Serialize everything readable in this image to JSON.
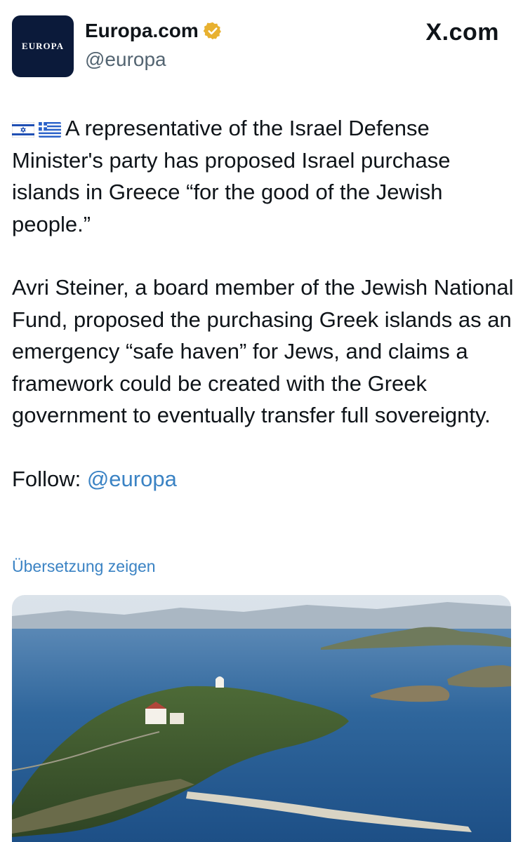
{
  "header": {
    "avatar_text": "EUROPA",
    "display_name": "Europa.com",
    "handle": "@europa",
    "site_label": "X.com",
    "verified_icon": "gold-verified-badge-icon"
  },
  "tweet": {
    "flags": [
      "israel-flag-icon",
      "greece-flag-icon"
    ],
    "paragraph1": "A representative of the Israel Defense Minister's party has proposed Israel purchase islands in Greece “for the good of the Jewish people.”",
    "paragraph2": "Avri Steiner, a board member of the Jewish National Fund, proposed the purchasing Greek islands as an emergency “safe haven” for Jews, and claims a framework could be created with the Greek government to eventually transfer full sovereignty.",
    "follow_label": "Follow:",
    "follow_mention": "@europa",
    "translate_label": "Übersetzung zeigen"
  },
  "colors": {
    "link": "#3b83c4",
    "text": "#0f1419",
    "secondary": "#536471",
    "verified_gold": "#e8b130",
    "avatar_bg": "#0b1a3a"
  }
}
